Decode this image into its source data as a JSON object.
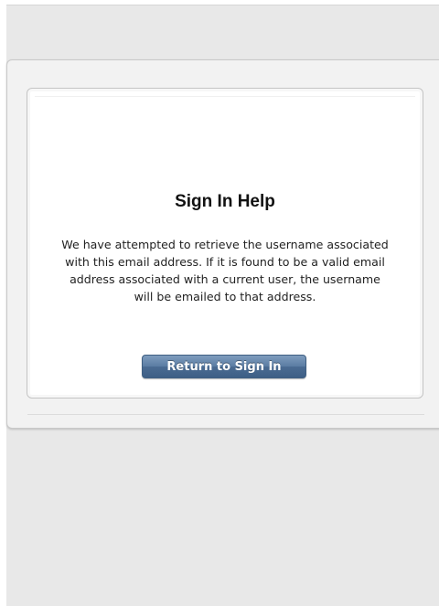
{
  "page": {
    "title": "Sign In Help",
    "message_lines": [
      "We have attempted to retrieve the username associated",
      "with this email address. If it is found to be a valid email",
      "address associated with a current user, the username",
      "will be emailed to that address."
    ],
    "return_button_label": "Return to Sign In"
  },
  "colors": {
    "background": "#e8e8e8",
    "panel": "#f2f2f2",
    "card": "#ffffff",
    "button": "#4a6b92",
    "button_text": "#ffffff",
    "text": "#222222"
  }
}
